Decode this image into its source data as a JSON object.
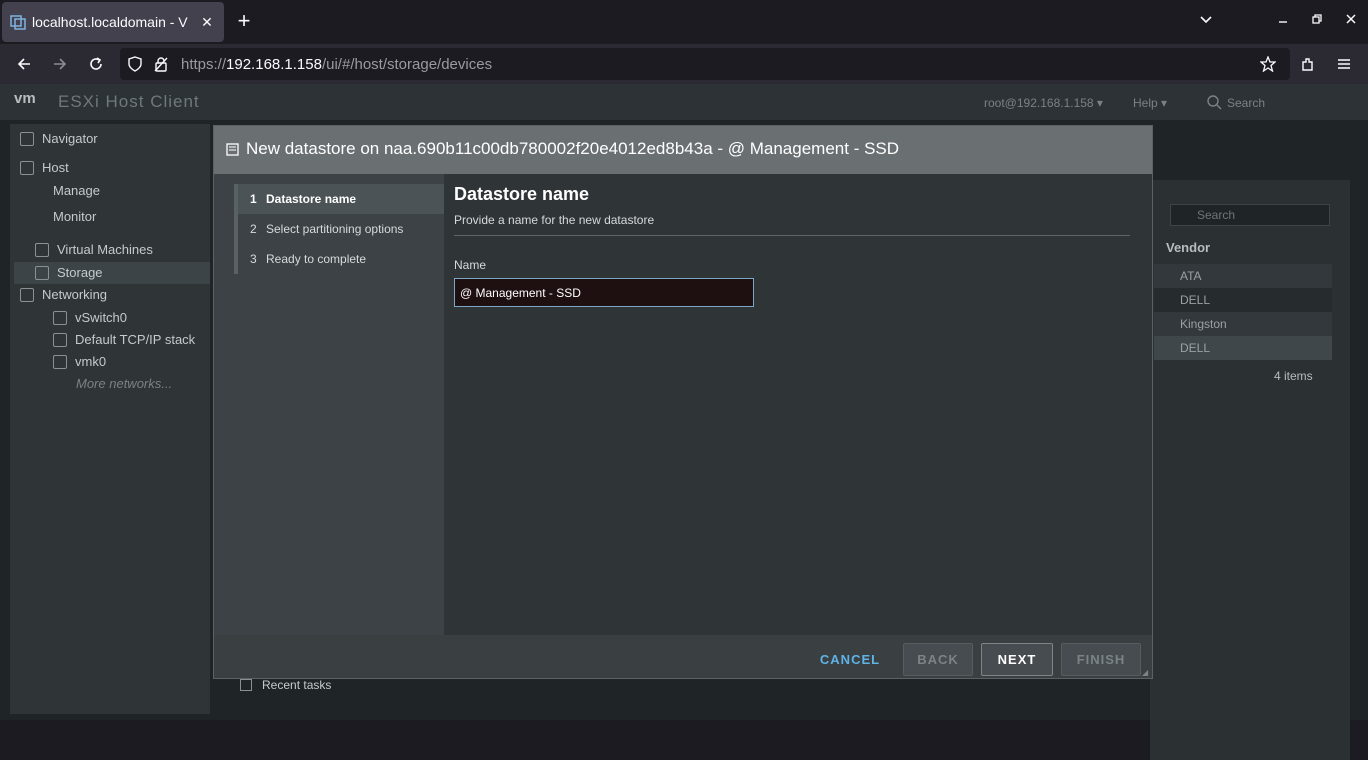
{
  "browser": {
    "tab_title": "localhost.localdomain - V",
    "tab_close": "✕",
    "new_tab": "+",
    "url_prefix": "https://",
    "url_host": "192.168.1.158",
    "url_path": "/ui/#/host/storage/devices"
  },
  "app": {
    "logo": "vm",
    "title": "ESXi Host Client",
    "user": "root@192.168.1.158 ▾",
    "help": "Help ▾",
    "search_placeholder": "Search"
  },
  "navigator": {
    "title": "Navigator",
    "items": [
      {
        "label": "Host"
      },
      {
        "label": "Manage"
      },
      {
        "label": "Monitor"
      },
      {
        "label": "Virtual Machines"
      },
      {
        "label": "Storage"
      },
      {
        "label": "Networking"
      },
      {
        "label": "vSwitch0"
      },
      {
        "label": "Default TCP/IP stack"
      },
      {
        "label": "vmk0"
      },
      {
        "label": "More networks..."
      }
    ]
  },
  "device_table": {
    "search_placeholder": "Search",
    "vendor_header": "Vendor",
    "vendors": [
      "ATA",
      "DELL",
      "Kingston",
      "DELL"
    ],
    "item_count": "4 items"
  },
  "recent_tasks": "Recent tasks",
  "modal": {
    "title": "New datastore on naa.690b11c00db780002f20e4012ed8b43a - @ Management - SSD",
    "steps": [
      {
        "num": "1",
        "label": "Datastore name"
      },
      {
        "num": "2",
        "label": "Select partitioning options"
      },
      {
        "num": "3",
        "label": "Ready to complete"
      }
    ],
    "content_title": "Datastore name",
    "content_subtitle": "Provide a name for the new datastore",
    "name_label": "Name",
    "name_value": "@ Management - SSD",
    "buttons": {
      "cancel": "CANCEL",
      "back": "BACK",
      "next": "NEXT",
      "finish": "FINISH"
    }
  },
  "colors": {
    "accent_link": "#5fb3e6",
    "modal_header": "#6a7072"
  }
}
